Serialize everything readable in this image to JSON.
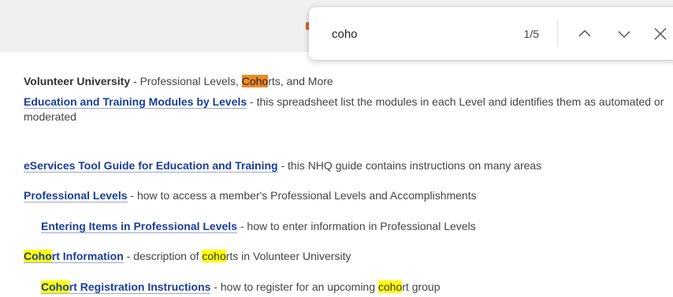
{
  "find_bar": {
    "query": "coho",
    "match_count": "1/5",
    "current_match": 1,
    "total_matches": 5,
    "icons": {
      "previous": "chevron-up-icon",
      "next": "chevron-down-icon",
      "close": "close-icon"
    }
  },
  "colors": {
    "link": "#1a3d9c",
    "active_highlight": "#f08a24",
    "highlight": "#ffff00"
  },
  "items": [
    {
      "title_prefix": "Volunteer University",
      "description_a": " - Professional Levels, ",
      "match": "Coho",
      "description_b": "rts, and More"
    },
    {
      "link": "Education and Training Modules by Levels",
      "description": " - this spreadsheet list the modules in each Level and identifies them as automated or moderated"
    },
    {
      "link": "eServices Tool Guide for Education and Training",
      "description": " - this NHQ guide contains instructions on many areas"
    },
    {
      "link": "Professional Levels",
      "description": " - how to access a member's Professional Levels and Accomplishments"
    },
    {
      "link": "Entering Items in Professional Levels",
      "description": " - how to enter information in Professional Levels"
    },
    {
      "link_match": "Coho",
      "link_rest": "rt Information",
      "description_a": " - description of ",
      "match": "coho",
      "description_b": "rts in Volunteer University"
    },
    {
      "link_match": "Coho",
      "link_rest": "rt Registration Instructions",
      "description_a": " - how to register for an upcoming ",
      "match": "coho",
      "description_b": "rt group"
    }
  ]
}
